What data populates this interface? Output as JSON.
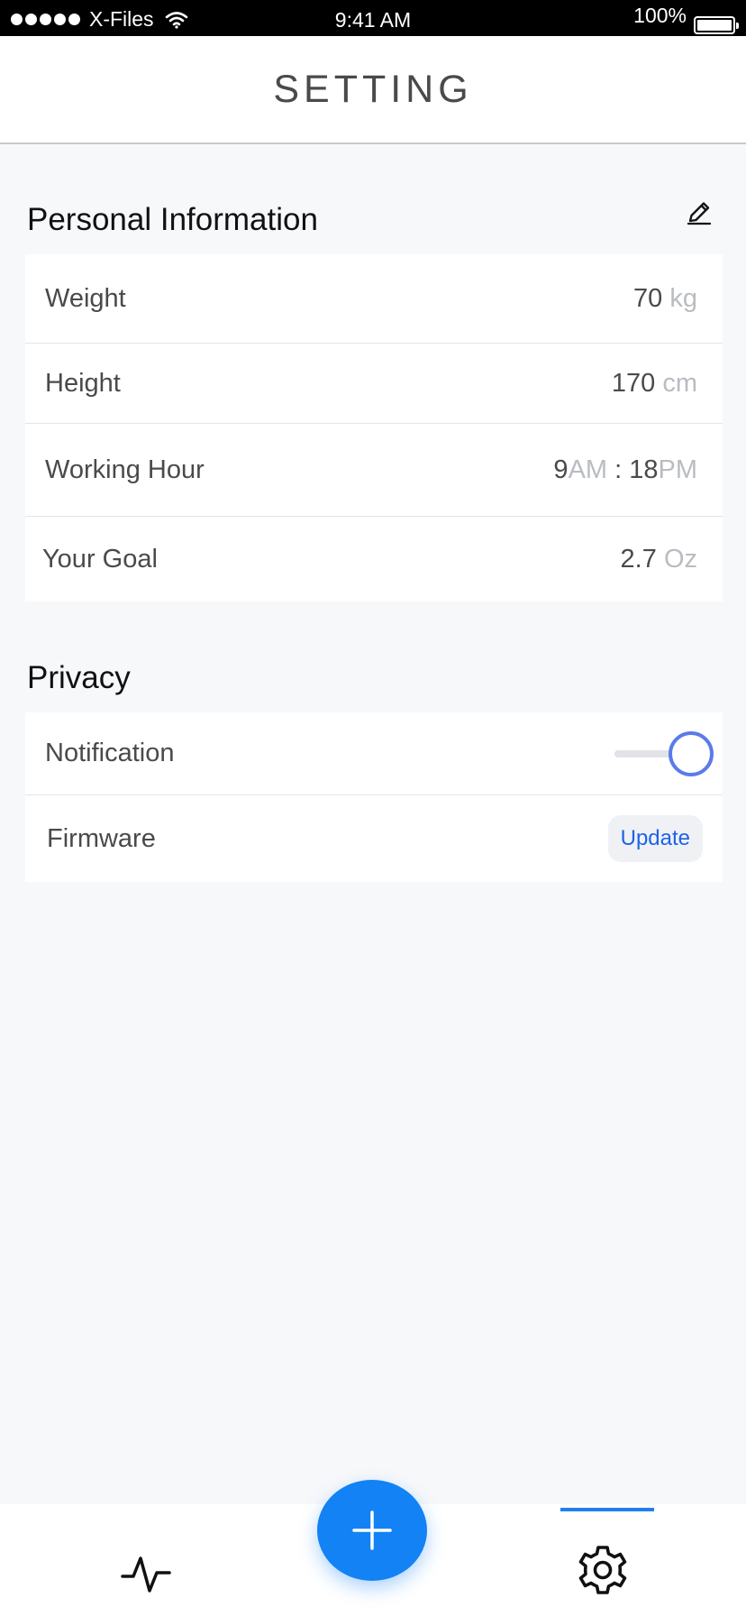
{
  "status_bar": {
    "carrier": "X-Files",
    "time": "9:41 AM",
    "battery": "100%"
  },
  "header": {
    "title": "SETTING"
  },
  "personal_info": {
    "heading": "Personal Information",
    "rows": [
      {
        "label": "Weight",
        "value": "70",
        "unit": "kg"
      },
      {
        "label": "Height",
        "value": "170",
        "unit": "cm"
      },
      {
        "label": "Working Hour",
        "start": "9",
        "start_unit": "AM",
        "separator": " : ",
        "end": "18",
        "end_unit": "PM"
      },
      {
        "label": "Your Goal",
        "value": "2.7",
        "unit": "Oz"
      }
    ]
  },
  "privacy": {
    "heading": "Privacy",
    "notification_label": "Notification",
    "notification_on": true,
    "firmware_label": "Firmware",
    "update_label": "Update"
  },
  "tab_bar": {
    "active_tab": "settings",
    "accent_color": "#1282f5"
  },
  "icons": [
    "wifi-icon",
    "battery-icon",
    "edit-pencil-icon",
    "activity-pulse-icon",
    "plus-icon",
    "gear-icon"
  ]
}
